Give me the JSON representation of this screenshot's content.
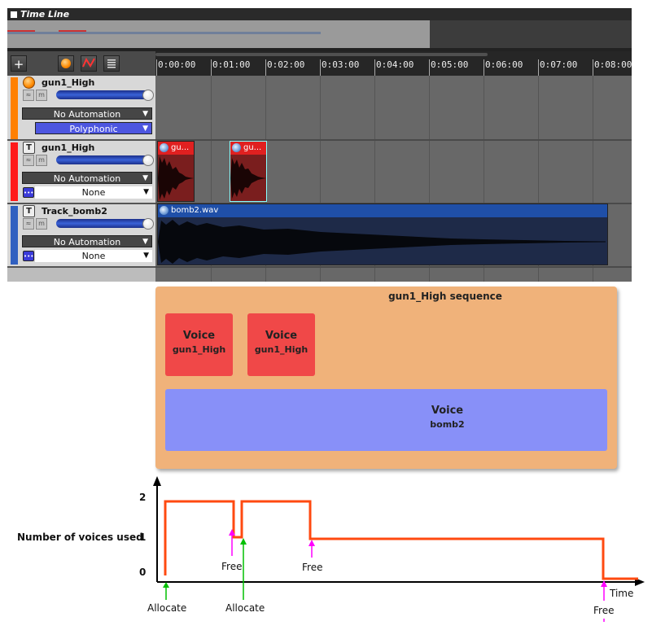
{
  "timeline": {
    "title": "Time Line",
    "toolbar": {
      "add_label": "+"
    },
    "ruler_ticks": [
      "0:00:00",
      "0:01:00",
      "0:02:00",
      "0:03:00",
      "0:04:00",
      "0:05:00",
      "0:06:00",
      "0:07:00",
      "0:08:00"
    ],
    "tracks": [
      {
        "name": "gun1_High",
        "color": "#ff8000",
        "automation": "No Automation",
        "mode": "Polyphonic"
      },
      {
        "name": "gun1_High",
        "color": "#ff1a1a",
        "automation": "No Automation",
        "mode": "None"
      },
      {
        "name": "Track_bomb2",
        "color": "#3060c0",
        "automation": "No Automation",
        "mode": "None"
      }
    ],
    "clips": [
      {
        "label": "gu..."
      },
      {
        "label": "gu..."
      },
      {
        "label": "bomb2.wav"
      }
    ]
  },
  "sequence": {
    "title": "gun1_High sequence",
    "voices": [
      {
        "line1": "Voice",
        "line2": "gun1_High",
        "color": "#f04848"
      },
      {
        "line1": "Voice",
        "line2": "gun1_High",
        "color": "#f04848"
      },
      {
        "line1": "Voice",
        "line2": "bomb2",
        "color": "#8890f8"
      }
    ]
  },
  "graph": {
    "ylabel": "Number of voices used",
    "xlabel": "Time",
    "yticks": [
      "2",
      "1",
      "0"
    ],
    "annotations": [
      {
        "text": "Allocate",
        "color": "#00c000"
      },
      {
        "text": "Free",
        "color": "#ff00ff"
      },
      {
        "text": "Allocate",
        "color": "#00c000"
      },
      {
        "text": "Free",
        "color": "#ff00ff"
      },
      {
        "text": "Free",
        "color": "#ff00ff"
      }
    ],
    "line_color": "#ff4a10"
  }
}
